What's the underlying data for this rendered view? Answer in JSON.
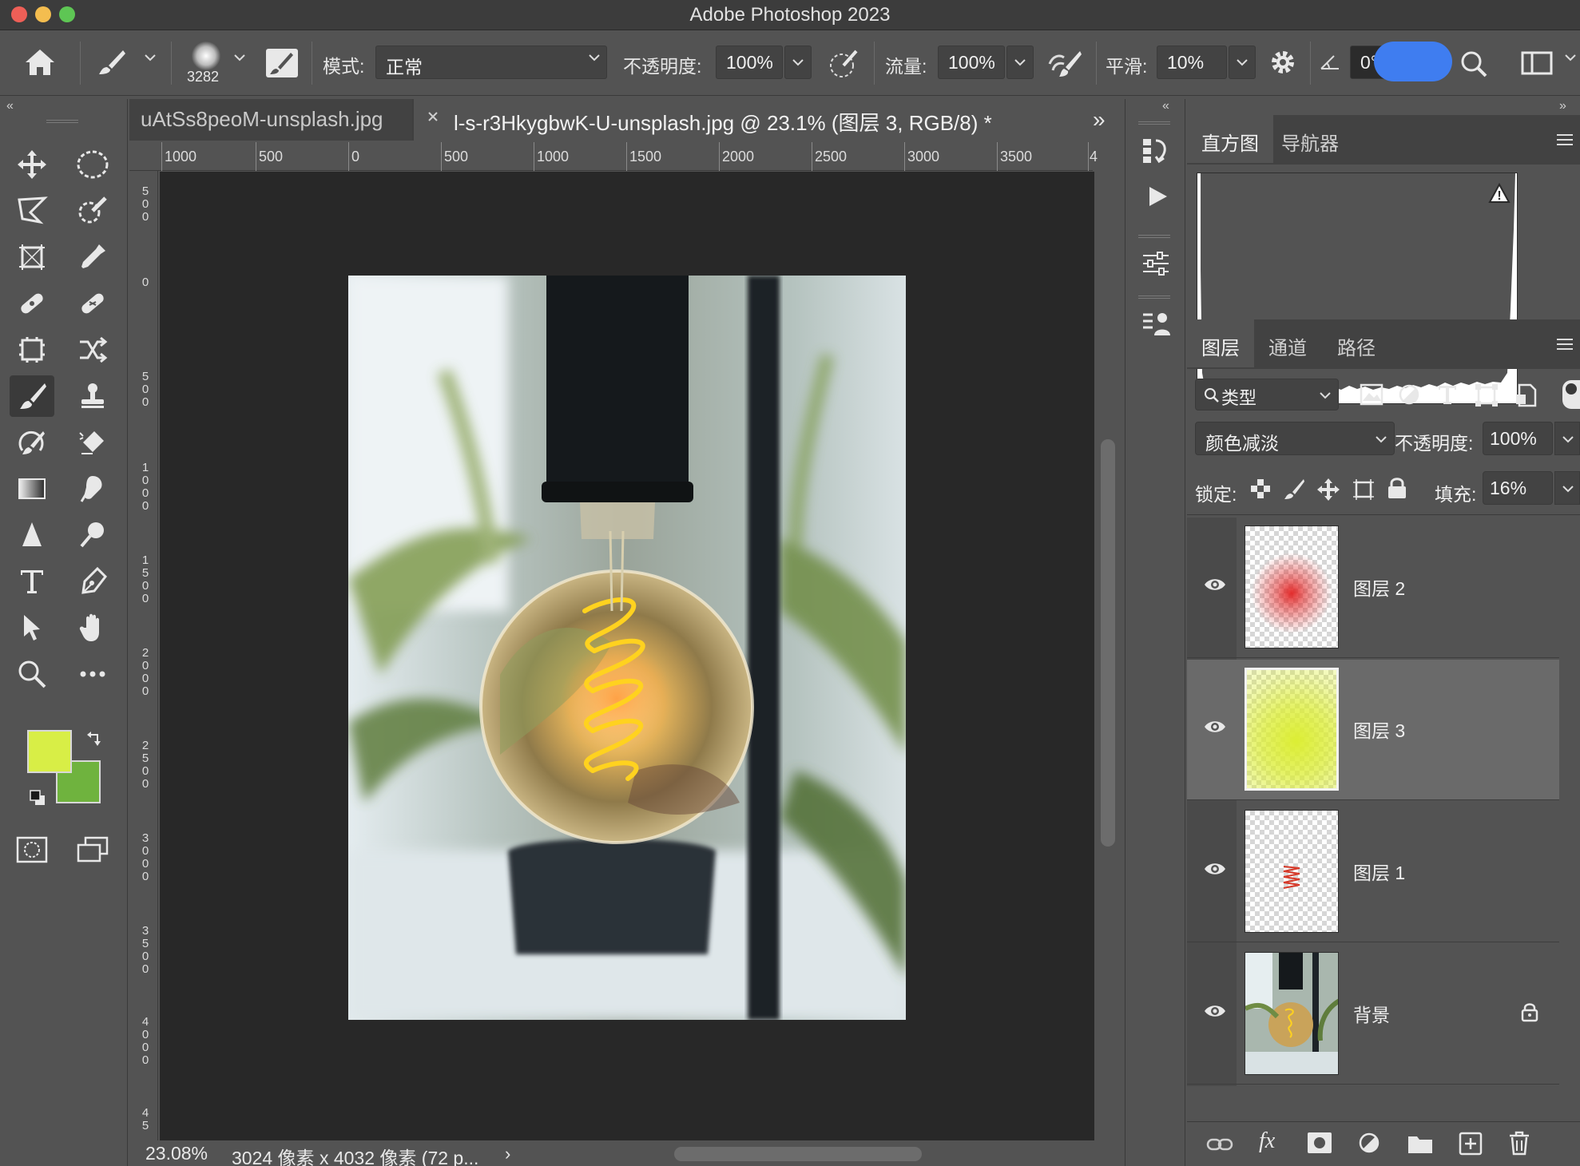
{
  "window": {
    "title": "Adobe Photoshop 2023"
  },
  "options_bar": {
    "brush_size": "3282",
    "mode_label": "模式:",
    "mode_value": "正常",
    "opacity_label": "不透明度:",
    "opacity_value": "100%",
    "flow_label": "流量:",
    "flow_value": "100%",
    "smoothing_label": "平滑:",
    "smoothing_value": "10%",
    "angle_value": "0°"
  },
  "doc_tabs": [
    {
      "label": "uAtSs8peoM-unsplash.jpg"
    },
    {
      "label": "l-s-r3HkygbwK-U-unsplash.jpg @ 23.1% (图层 3, RGB/8) *"
    }
  ],
  "ruler_top": [
    "1000",
    "500",
    "0",
    "500",
    "1000",
    "1500",
    "2000",
    "2500",
    "3000",
    "3500",
    "4"
  ],
  "ruler_left": [
    "5\n0\n0",
    "0",
    "5\n0\n0",
    "1\n0\n0\n0",
    "1\n5\n0\n0",
    "2\n0\n0\n0",
    "2\n5\n0\n0",
    "3\n0\n0\n0",
    "3\n5\n0\n0",
    "4\n0\n0\n0",
    "4\n5"
  ],
  "status": {
    "zoom": "23.08%",
    "doc_info": "3024 像素 x 4032 像素 (72 p..."
  },
  "colors": {
    "foreground": "#d8ee46",
    "background": "#6fb33e",
    "accent_toggle": "#3f7df0"
  },
  "panels": {
    "top_tabs": [
      "直方图",
      "导航器"
    ],
    "layers_tabs": [
      "图层",
      "通道",
      "路径"
    ],
    "filter_label": "类型",
    "blend_mode": "颜色减淡",
    "opacity_label": "不透明度:",
    "opacity_value": "100%",
    "lock_label": "锁定:",
    "fill_label": "填充:",
    "fill_value": "16%"
  },
  "layers": [
    {
      "name": "图层 2",
      "selected": false,
      "locked": false
    },
    {
      "name": "图层 3",
      "selected": true,
      "locked": false
    },
    {
      "name": "图层 1",
      "selected": false,
      "locked": false
    },
    {
      "name": "背景",
      "selected": false,
      "locked": true
    }
  ]
}
